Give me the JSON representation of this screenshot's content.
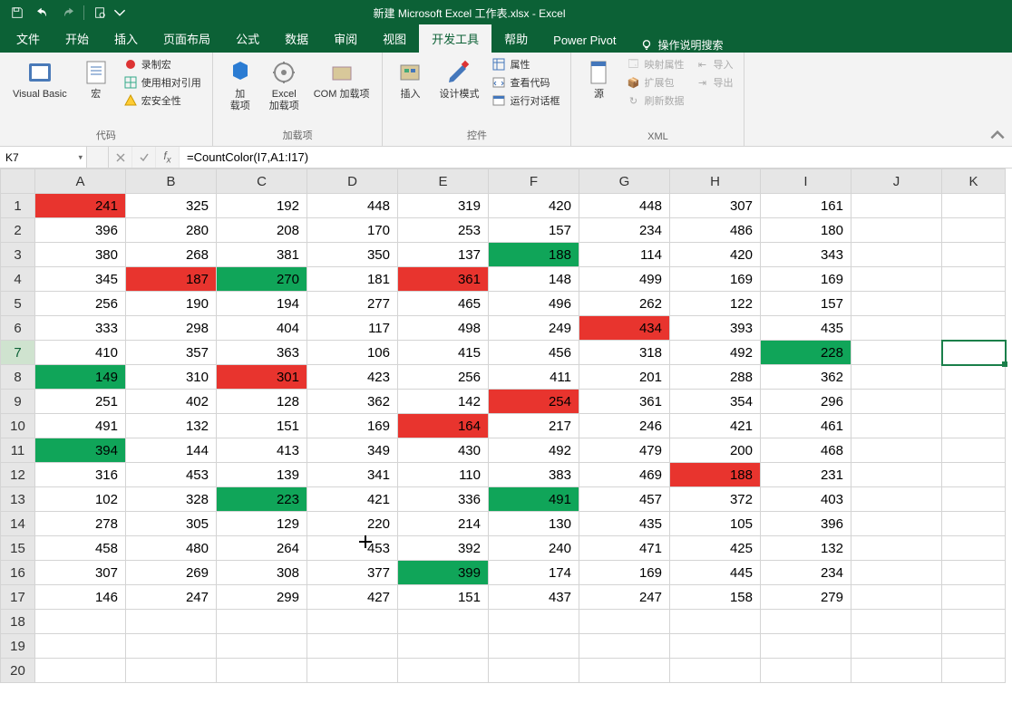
{
  "title": "新建 Microsoft Excel 工作表.xlsx  -  Excel",
  "qat": {
    "save": "保存",
    "undo": "撤消",
    "redo": "恢复",
    "preview": "打印预览"
  },
  "tabs": {
    "file": "文件",
    "home": "开始",
    "insert": "插入",
    "layout": "页面布局",
    "formulas": "公式",
    "data": "数据",
    "review": "审阅",
    "view": "视图",
    "developer": "开发工具",
    "help": "帮助",
    "powerpivot": "Power Pivot",
    "tellme": "操作说明搜索"
  },
  "ribbon": {
    "code": {
      "label": "代码",
      "vb": "Visual Basic",
      "macros": "宏",
      "record": "录制宏",
      "relref": "使用相对引用",
      "security": "宏安全性"
    },
    "addins": {
      "label": "加载项",
      "addins": "加\n载项",
      "excel": "Excel\n加载项",
      "com": "COM 加载项"
    },
    "controls": {
      "label": "控件",
      "insert": "插入",
      "design": "设计模式",
      "props": "属性",
      "viewcode": "查看代码",
      "dialog": "运行对话框"
    },
    "xml": {
      "label": "XML",
      "source": "源",
      "mapprops": "映射属性",
      "expand": "扩展包",
      "refresh": "刷新数据",
      "import": "导入",
      "export": "导出"
    }
  },
  "nameBox": "K7",
  "formula": "=CountColor(I7,A1:I17)",
  "columns": [
    "A",
    "B",
    "C",
    "D",
    "E",
    "F",
    "G",
    "H",
    "I",
    "J",
    "K"
  ],
  "rows": [
    "1",
    "2",
    "3",
    "4",
    "5",
    "6",
    "7",
    "8",
    "9",
    "10",
    "11",
    "12",
    "13",
    "14",
    "15",
    "16",
    "17",
    "18",
    "19",
    "20"
  ],
  "data": [
    [
      {
        "v": 241,
        "c": "red"
      },
      {
        "v": 325
      },
      {
        "v": 192
      },
      {
        "v": 448
      },
      {
        "v": 319
      },
      {
        "v": 420
      },
      {
        "v": 448
      },
      {
        "v": 307
      },
      {
        "v": 161
      },
      {
        "v": ""
      },
      {
        "v": ""
      }
    ],
    [
      {
        "v": 396
      },
      {
        "v": 280
      },
      {
        "v": 208
      },
      {
        "v": 170
      },
      {
        "v": 253
      },
      {
        "v": 157
      },
      {
        "v": 234
      },
      {
        "v": 486
      },
      {
        "v": 180
      },
      {
        "v": ""
      },
      {
        "v": ""
      }
    ],
    [
      {
        "v": 380
      },
      {
        "v": 268
      },
      {
        "v": 381
      },
      {
        "v": 350
      },
      {
        "v": 137
      },
      {
        "v": 188,
        "c": "green"
      },
      {
        "v": 114
      },
      {
        "v": 420
      },
      {
        "v": 343
      },
      {
        "v": ""
      },
      {
        "v": ""
      }
    ],
    [
      {
        "v": 345
      },
      {
        "v": 187,
        "c": "red"
      },
      {
        "v": 270,
        "c": "green"
      },
      {
        "v": 181
      },
      {
        "v": 361,
        "c": "red"
      },
      {
        "v": 148
      },
      {
        "v": 499
      },
      {
        "v": 169
      },
      {
        "v": 169
      },
      {
        "v": ""
      },
      {
        "v": ""
      }
    ],
    [
      {
        "v": 256
      },
      {
        "v": 190
      },
      {
        "v": 194
      },
      {
        "v": 277
      },
      {
        "v": 465
      },
      {
        "v": 496
      },
      {
        "v": 262
      },
      {
        "v": 122
      },
      {
        "v": 157
      },
      {
        "v": ""
      },
      {
        "v": ""
      }
    ],
    [
      {
        "v": 333
      },
      {
        "v": 298
      },
      {
        "v": 404
      },
      {
        "v": 117
      },
      {
        "v": 498
      },
      {
        "v": 249
      },
      {
        "v": 434,
        "c": "red"
      },
      {
        "v": 393
      },
      {
        "v": 435
      },
      {
        "v": ""
      },
      {
        "v": ""
      }
    ],
    [
      {
        "v": 410
      },
      {
        "v": 357
      },
      {
        "v": 363
      },
      {
        "v": 106
      },
      {
        "v": 415
      },
      {
        "v": 456
      },
      {
        "v": 318
      },
      {
        "v": 492
      },
      {
        "v": 228,
        "c": "green"
      },
      {
        "v": ""
      },
      {
        "v": "",
        "sel": true
      }
    ],
    [
      {
        "v": 149,
        "c": "green"
      },
      {
        "v": 310
      },
      {
        "v": 301,
        "c": "red"
      },
      {
        "v": 423
      },
      {
        "v": 256
      },
      {
        "v": 411
      },
      {
        "v": 201
      },
      {
        "v": 288
      },
      {
        "v": 362
      },
      {
        "v": ""
      },
      {
        "v": ""
      }
    ],
    [
      {
        "v": 251
      },
      {
        "v": 402
      },
      {
        "v": 128
      },
      {
        "v": 362
      },
      {
        "v": 142
      },
      {
        "v": 254,
        "c": "red"
      },
      {
        "v": 361
      },
      {
        "v": 354
      },
      {
        "v": 296
      },
      {
        "v": ""
      },
      {
        "v": ""
      }
    ],
    [
      {
        "v": 491
      },
      {
        "v": 132
      },
      {
        "v": 151
      },
      {
        "v": 169
      },
      {
        "v": 164,
        "c": "red"
      },
      {
        "v": 217
      },
      {
        "v": 246
      },
      {
        "v": 421
      },
      {
        "v": 461
      },
      {
        "v": ""
      },
      {
        "v": ""
      }
    ],
    [
      {
        "v": 394,
        "c": "green"
      },
      {
        "v": 144
      },
      {
        "v": 413
      },
      {
        "v": 349
      },
      {
        "v": 430
      },
      {
        "v": 492
      },
      {
        "v": 479
      },
      {
        "v": 200
      },
      {
        "v": 468
      },
      {
        "v": ""
      },
      {
        "v": ""
      }
    ],
    [
      {
        "v": 316
      },
      {
        "v": 453
      },
      {
        "v": 139
      },
      {
        "v": 341
      },
      {
        "v": 110
      },
      {
        "v": 383
      },
      {
        "v": 469
      },
      {
        "v": 188,
        "c": "red"
      },
      {
        "v": 231
      },
      {
        "v": ""
      },
      {
        "v": ""
      }
    ],
    [
      {
        "v": 102
      },
      {
        "v": 328
      },
      {
        "v": 223,
        "c": "green"
      },
      {
        "v": 421
      },
      {
        "v": 336
      },
      {
        "v": 491,
        "c": "green"
      },
      {
        "v": 457
      },
      {
        "v": 372
      },
      {
        "v": 403
      },
      {
        "v": ""
      },
      {
        "v": ""
      }
    ],
    [
      {
        "v": 278
      },
      {
        "v": 305
      },
      {
        "v": 129
      },
      {
        "v": 220
      },
      {
        "v": 214
      },
      {
        "v": 130
      },
      {
        "v": 435
      },
      {
        "v": 105
      },
      {
        "v": 396
      },
      {
        "v": ""
      },
      {
        "v": ""
      }
    ],
    [
      {
        "v": 458
      },
      {
        "v": 480
      },
      {
        "v": 264
      },
      {
        "v": 453
      },
      {
        "v": 392
      },
      {
        "v": 240
      },
      {
        "v": 471
      },
      {
        "v": 425
      },
      {
        "v": 132
      },
      {
        "v": ""
      },
      {
        "v": ""
      }
    ],
    [
      {
        "v": 307
      },
      {
        "v": 269
      },
      {
        "v": 308
      },
      {
        "v": 377
      },
      {
        "v": 399,
        "c": "green"
      },
      {
        "v": 174
      },
      {
        "v": 169
      },
      {
        "v": 445
      },
      {
        "v": 234
      },
      {
        "v": ""
      },
      {
        "v": ""
      }
    ],
    [
      {
        "v": 146
      },
      {
        "v": 247
      },
      {
        "v": 299
      },
      {
        "v": 427
      },
      {
        "v": 151
      },
      {
        "v": 437
      },
      {
        "v": 247
      },
      {
        "v": 158
      },
      {
        "v": 279
      },
      {
        "v": ""
      },
      {
        "v": ""
      }
    ],
    [
      {
        "v": ""
      },
      {
        "v": ""
      },
      {
        "v": ""
      },
      {
        "v": ""
      },
      {
        "v": ""
      },
      {
        "v": ""
      },
      {
        "v": ""
      },
      {
        "v": ""
      },
      {
        "v": ""
      },
      {
        "v": ""
      },
      {
        "v": ""
      }
    ],
    [
      {
        "v": ""
      },
      {
        "v": ""
      },
      {
        "v": ""
      },
      {
        "v": ""
      },
      {
        "v": ""
      },
      {
        "v": ""
      },
      {
        "v": ""
      },
      {
        "v": ""
      },
      {
        "v": ""
      },
      {
        "v": ""
      },
      {
        "v": ""
      }
    ],
    [
      {
        "v": ""
      },
      {
        "v": ""
      },
      {
        "v": ""
      },
      {
        "v": ""
      },
      {
        "v": ""
      },
      {
        "v": ""
      },
      {
        "v": ""
      },
      {
        "v": ""
      },
      {
        "v": ""
      },
      {
        "v": ""
      },
      {
        "v": ""
      }
    ]
  ]
}
